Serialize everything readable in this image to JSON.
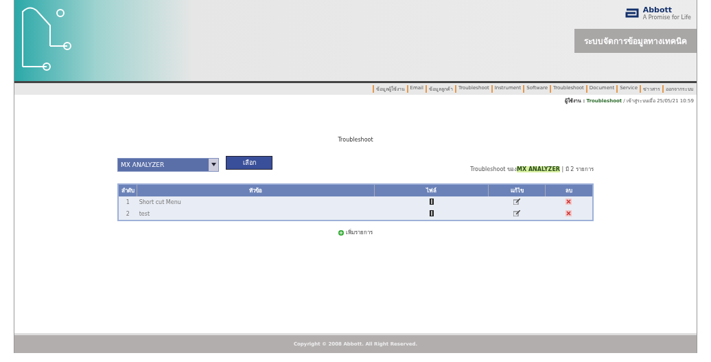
{
  "header": {
    "logo": "Abbott",
    "logo_sub": "A Promise for Life",
    "title": "ระบบจัดการข้อมูลทางเทคนิค"
  },
  "nav": [
    "ข้อมูลผู้ใช้งาน",
    "Email",
    "ข้อมูลลูกค้า",
    "Troubleshoot",
    "Instrument",
    "Software",
    "Troubleshoot",
    "Document",
    "Service",
    "ข่าวสาร",
    "ออกจากระบบ"
  ],
  "user_line": {
    "label": "ผู้ใช้งาน :",
    "name": "Troubleshoot",
    "info": "/ เข้าสู่ระบบเมื่อ 25/05/21 10:59"
  },
  "page_title": "Troubleshoot",
  "instrument_select": {
    "value": "MX ANALYZER"
  },
  "select_button": "เลือก",
  "summary": {
    "prefix": "Troubleshoot ของ",
    "link": "MX ANALYZER",
    "suffix": "| มี 2 รายการ"
  },
  "table": {
    "columns": [
      "ลำดับ",
      "หัวข้อ",
      "ไฟล์",
      "แก้ไข",
      "ลบ"
    ],
    "rows": [
      {
        "no": "1",
        "topic": "Short cut Menu"
      },
      {
        "no": "2",
        "topic": "test"
      }
    ]
  },
  "add_link": "เพิ่มรายการ",
  "footer": "Copyright © 2008 Abbott. All Right Reserved."
}
